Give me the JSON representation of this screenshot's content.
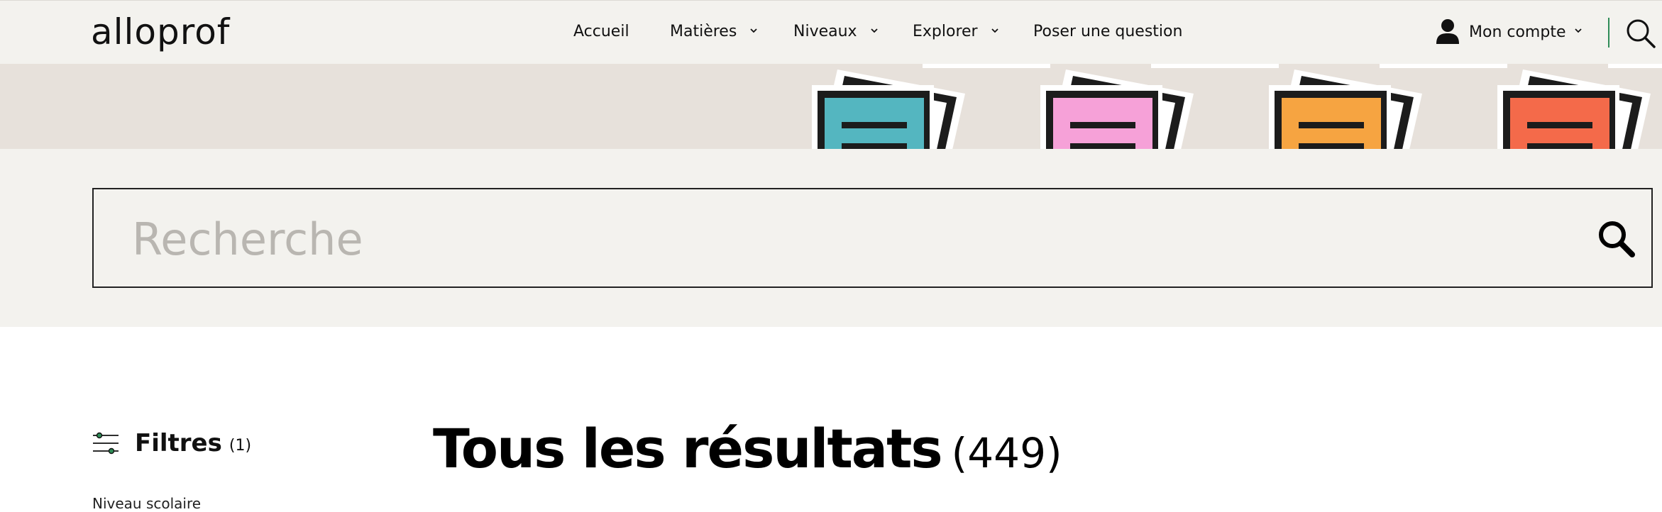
{
  "header": {
    "logo": "alloprof",
    "nav": [
      {
        "label": "Accueil"
      },
      {
        "label": "Matières"
      },
      {
        "label": "Niveaux"
      },
      {
        "label": "Explorer"
      },
      {
        "label": "Poser une question"
      }
    ],
    "account_label": "Mon compte"
  },
  "banner": {
    "doc_colors": [
      "#54b6c0",
      "#f6a1d8",
      "#f6a441",
      "#f46a4a"
    ]
  },
  "search": {
    "placeholder": "Recherche",
    "value": ""
  },
  "filters": {
    "label": "Filtres",
    "count": "(1)",
    "first_group": "Niveau scolaire"
  },
  "results": {
    "title": "Tous les résultats",
    "count": "(449)"
  },
  "colors": {
    "header_bg": "#f3f2ee",
    "banner_bg": "#e7e1db",
    "accent_green": "#2f8c57"
  },
  "icons": [
    "chevron-down-icon",
    "user-icon",
    "search-icon",
    "filter-sliders-icon",
    "document-icon"
  ]
}
